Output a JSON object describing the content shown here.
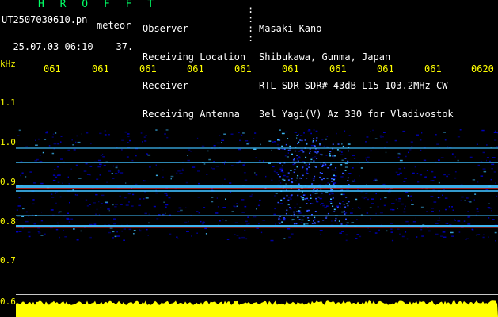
{
  "app_title": "H R O F F T",
  "file_name": "UT2507030610.pn",
  "meteor_label": "meteor",
  "timestamp": "25.07.03 06:10",
  "timestamp_extra": "37.",
  "header": {
    "labels": [
      "Observer",
      "Receiving Location",
      "Receiver",
      "Receiving Antenna"
    ],
    "values": [
      "Masaki Kano",
      "Shibukawa, Gunma, Japan",
      "RTL-SDR SDR# 43dB L15 103.2MHz CW",
      "3el Yagi(V) Az 330 for Vladivostok"
    ]
  },
  "y_axis": {
    "unit": "kHz",
    "ticks": [
      "1.1",
      "1.0",
      "0.9",
      "0.8",
      "0.7",
      "0.6"
    ]
  },
  "x_axis": {
    "ticks": [
      "061",
      "061",
      "061",
      "061",
      "061",
      "061",
      "061",
      "061",
      "061",
      "0620"
    ]
  },
  "colors": {
    "text_yellow": "#ffff00",
    "text_white": "#ffffff",
    "title_green": "#00ff66",
    "noise_blue": "#0000c8",
    "signal_cyan": "#40c0ff",
    "signal_hot": "#ff3030"
  }
}
